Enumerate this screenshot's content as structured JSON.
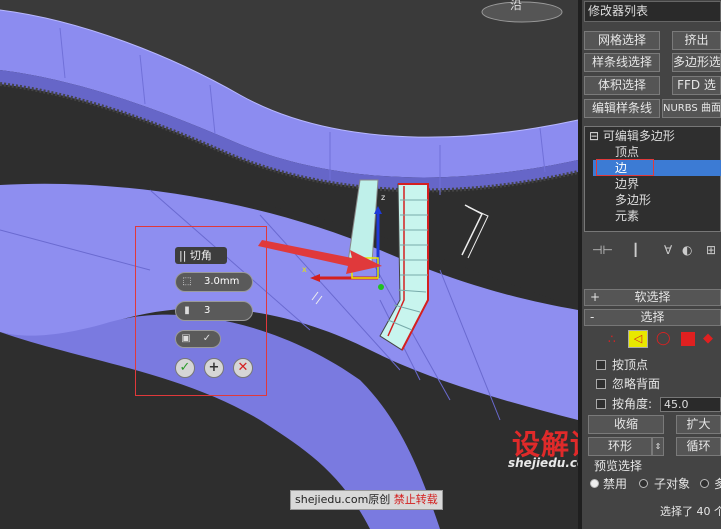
{
  "caddy": {
    "title": "|| 切角",
    "amount": "3.0mm",
    "segments": "3",
    "confirm_icon": "check-icon",
    "apply_icon": "plus-icon",
    "cancel_icon": "close-icon"
  },
  "viewport": {
    "label_fragment": "沿"
  },
  "watermark": {
    "logo": "设解读",
    "url": "shejiedu.com",
    "bar_site": "shejiedu.com原创",
    "bar_notice": "禁止转载"
  },
  "panel": {
    "modifier_list": "修改器列表",
    "buttons": [
      {
        "label": "网格选择"
      },
      {
        "label": "挤出"
      },
      {
        "label": "样条线选择"
      },
      {
        "label": "多边形选"
      },
      {
        "label": "体积选择"
      },
      {
        "label": "FFD 选"
      },
      {
        "label": "编辑样条线"
      },
      {
        "label": "NURBS 曲面"
      }
    ],
    "stack": {
      "root": "可编辑多边形",
      "items": [
        "顶点",
        "边",
        "边界",
        "多边形",
        "元素"
      ],
      "selected": "边"
    },
    "rollouts": {
      "soft_select": "软选择",
      "select": "选择"
    },
    "options": {
      "by_vertex": "按顶点",
      "ignore_backfacing": "忽略背面",
      "by_angle": "按角度:",
      "angle_value": "45.0"
    },
    "buttons2": {
      "shrink": "收缩",
      "grow": "扩大",
      "ring": "环形",
      "loop": "循环"
    },
    "preview": {
      "title": "预览选择",
      "disable": "禁用",
      "subobject": "子对象",
      "multi": "多"
    },
    "status": "选择了 40 个"
  },
  "colors": {
    "accent": "#3c7bd4",
    "highlight": "#e0393b",
    "geometry": "#8f8ff0"
  }
}
